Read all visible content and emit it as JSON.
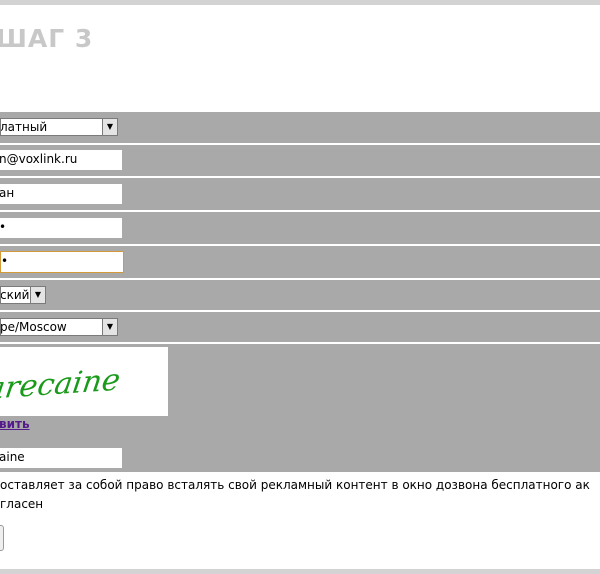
{
  "page": {
    "title": "ШАГ 3"
  },
  "form": {
    "tariff_select": {
      "selected": "латный"
    },
    "email_field": {
      "value": "n@voxlink.ru"
    },
    "name_field": {
      "value": "ан"
    },
    "password_field": {
      "value": "•"
    },
    "password_confirm_field": {
      "value": "•"
    },
    "language_select": {
      "selected": "ский"
    },
    "timezone_select": {
      "selected": "pe/Moscow"
    },
    "captcha": {
      "image_text": "arecaine",
      "image_color": "#1a9a1a",
      "refresh_link": "вить"
    },
    "captcha_field": {
      "value": "aine"
    },
    "notice_line1": "оставляет за собой право всталять свой рекламный контент в окно дозвона бесплатного ак",
    "notice_line2": "гласен"
  },
  "colors": {
    "row_background": "#a9a9a9",
    "focus_border": "#d39a3a",
    "title_color": "#c8c8c8",
    "link_color": "#551a8b"
  },
  "icons": {
    "dropdown": "chevron-down-icon"
  }
}
